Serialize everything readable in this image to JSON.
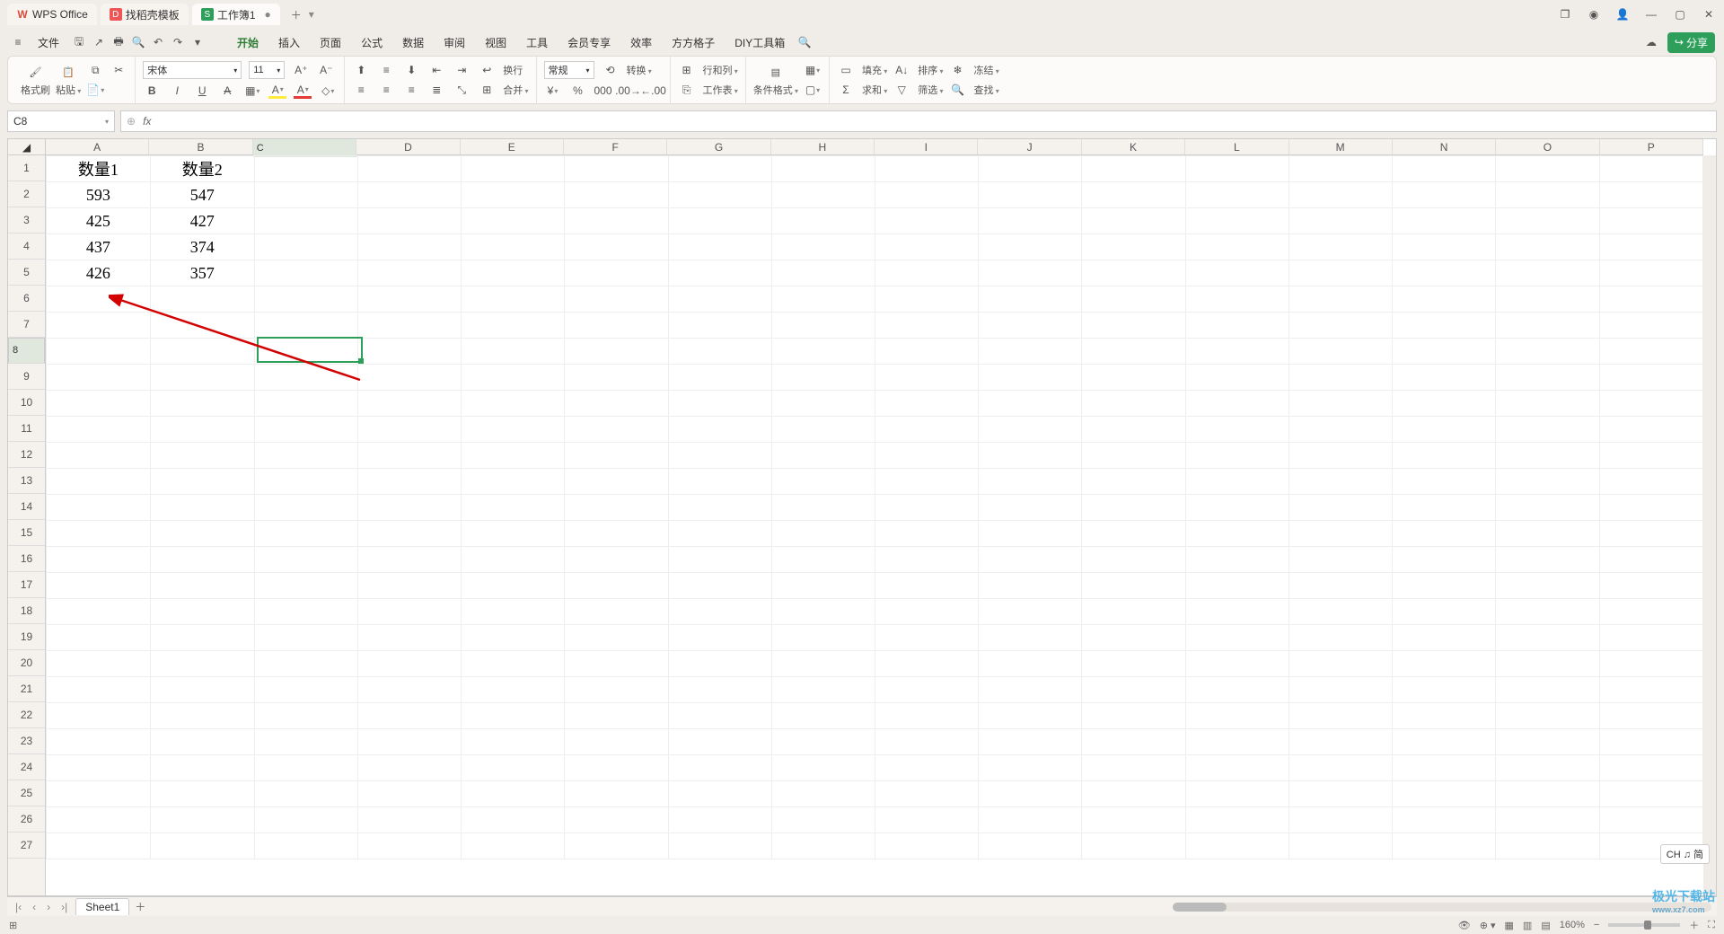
{
  "tabs": [
    {
      "label": "WPS Office",
      "icon": "wps-icon"
    },
    {
      "label": "找稻壳模板",
      "icon": "docer-icon"
    },
    {
      "label": "工作簿1",
      "icon": "sheet-icon",
      "active": true,
      "dirty": "●"
    }
  ],
  "menu": {
    "file": "文件",
    "items": [
      "开始",
      "插入",
      "页面",
      "公式",
      "数据",
      "审阅",
      "视图",
      "工具",
      "会员专享",
      "效率",
      "方方格子",
      "DIY工具箱"
    ],
    "active_index": 0
  },
  "share": "分享",
  "ribbon": {
    "format_painter": "格式刷",
    "paste": "粘贴",
    "font_name": "宋体",
    "font_size": "11",
    "wrap": "换行",
    "merge": "合并",
    "number_format": "常规",
    "convert": "转换",
    "row_col": "行和列",
    "worksheet": "工作表",
    "cond_format": "条件格式",
    "fill": "填充",
    "sort": "排序",
    "freeze": "冻结",
    "sum": "求和",
    "filter": "筛选",
    "find": "查找"
  },
  "name_box": "C8",
  "columns": [
    "A",
    "B",
    "C",
    "D",
    "E",
    "F",
    "G",
    "H",
    "I",
    "J",
    "K",
    "L",
    "M",
    "N",
    "O",
    "P"
  ],
  "rows_shown": 27,
  "selected": {
    "col": 2,
    "row": 7
  },
  "data": {
    "A1": "数量1",
    "B1": "数量2",
    "A2": "593",
    "B2": "547",
    "A3": "425",
    "B3": "427",
    "A4": "437",
    "B4": "374",
    "A5": "426",
    "B5": "357"
  },
  "sheet": "Sheet1",
  "zoom": "160%",
  "ime": "CH ♫ 简",
  "watermark": {
    "title": "极光下载站",
    "url": "www.xz7.com"
  }
}
